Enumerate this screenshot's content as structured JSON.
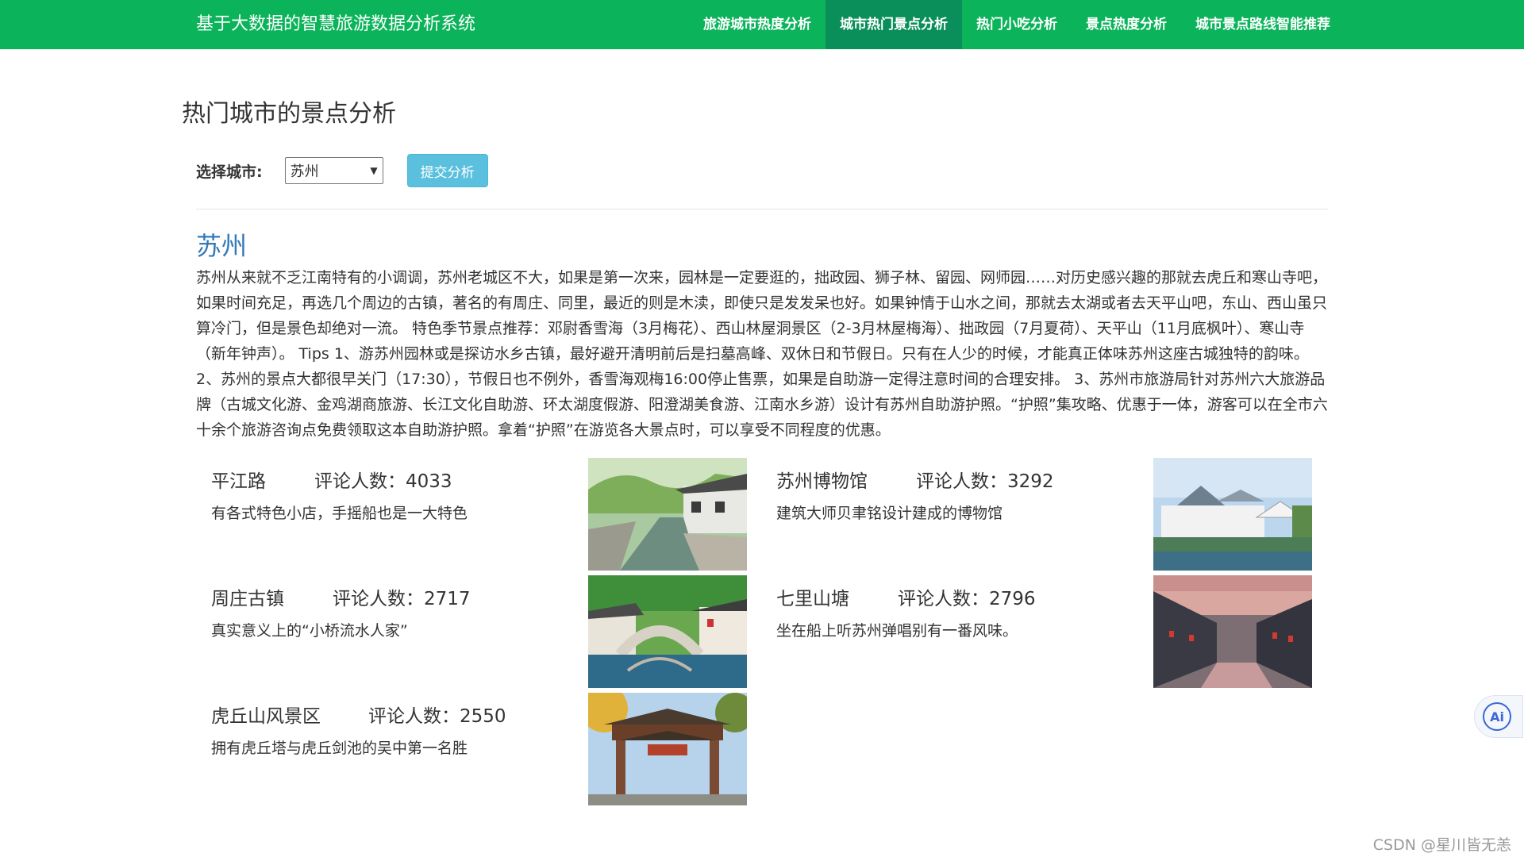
{
  "header": {
    "brand": "基于大数据的智慧旅游数据分析系统",
    "nav": [
      {
        "label": "旅游城市热度分析"
      },
      {
        "label": "城市热门景点分析"
      },
      {
        "label": "热门小吃分析"
      },
      {
        "label": "景点热度分析"
      },
      {
        "label": "城市景点路线智能推荐"
      }
    ],
    "active_index": 1
  },
  "page_title": "热门城市的景点分析",
  "filter": {
    "label": "选择城市:",
    "selected_city": "苏州",
    "submit_label": "提交分析"
  },
  "city": {
    "name": "苏州",
    "description": "苏州从来就不乏江南特有的小调调，苏州老城区不大，如果是第一次来，园林是一定要逛的，拙政园、狮子林、留园、网师园……对历史感兴趣的那就去虎丘和寒山寺吧，如果时间充足，再选几个周边的古镇，著名的有周庄、同里，最近的则是木渎，即使只是发发呆也好。如果钟情于山水之间，那就去太湖或者去天平山吧，东山、西山虽只算冷门，但是景色却绝对一流。 特色季节景点推荐：邓尉香雪海（3月梅花）、西山林屋洞景区（2-3月林屋梅海）、拙政园（7月夏荷）、天平山（11月底枫叶）、寒山寺（新年钟声）。 Tips 1、游苏州园林或是探访水乡古镇，最好避开清明前后是扫墓高峰、双休日和节假日。只有在人少的时候，才能真正体味苏州这座古城独特的韵味。 2、苏州的景点大都很早关门（17:30），节假日也不例外，香雪海观梅16:00停止售票，如果是自助游一定得注意时间的合理安排。 3、苏州市旅游局针对苏州六大旅游品牌（古城文化游、金鸡湖商旅游、长江文化自助游、环太湖度假游、阳澄湖美食游、江南水乡游）设计有苏州自助游护照。“护照”集攻略、优惠于一体，游客可以在全市六十余个旅游咨询点免费领取这本自助游护照。拿着“护照”在游览各大景点时，可以享受不同程度的优惠。"
  },
  "count_label": "评论人数：",
  "spots": [
    {
      "name": "平江路",
      "count": "4033",
      "desc": "有各式特色小店，手摇船也是一大特色",
      "image": "canal-street-photo"
    },
    {
      "name": "苏州博物馆",
      "count": "3292",
      "desc": "建筑大师贝聿铭设计建成的博物馆",
      "image": "museum-photo"
    },
    {
      "name": "周庄古镇",
      "count": "2717",
      "desc": "真实意义上的“小桥流水人家”",
      "image": "bridge-town-photo"
    },
    {
      "name": "七里山塘",
      "count": "2796",
      "desc": "坐在船上听苏州弹唱别有一番风味。",
      "image": "lantern-canal-photo"
    },
    {
      "name": "虎丘山风景区",
      "count": "2550",
      "desc": "拥有虎丘塔与虎丘剑池的吴中第一名胜",
      "image": "gate-photo"
    }
  ],
  "ai_button": "Ai",
  "watermark": "CSDN @星川皆无恙",
  "colors": {
    "nav_bg": "#0bb35a",
    "nav_active": "#0a8f5a",
    "city_link": "#337ab7",
    "button": "#5bc0de"
  }
}
